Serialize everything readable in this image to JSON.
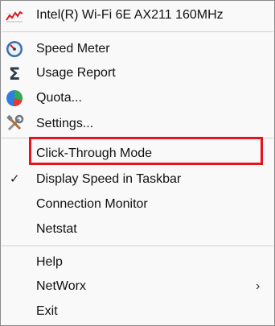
{
  "menu": {
    "adapter_label": "Intel(R) Wi-Fi 6E AX211 160MHz",
    "speed_meter": "Speed Meter",
    "usage_report": "Usage Report",
    "quota": "Quota...",
    "settings": "Settings...",
    "click_through": "Click-Through Mode",
    "display_speed": "Display Speed in Taskbar",
    "connection_monitor": "Connection Monitor",
    "netstat": "Netstat",
    "help": "Help",
    "networx": "NetWorx",
    "exit": "Exit"
  },
  "icons": {
    "adapter": "network-graph-icon",
    "speed_meter": "speedometer-icon",
    "usage_report": "sigma-icon",
    "quota": "pie-chart-icon",
    "settings": "tools-icon",
    "check": "checkmark-icon",
    "submenu": "chevron-right-icon"
  },
  "glyphs": {
    "check": "✓",
    "submenu": "›"
  },
  "colors": {
    "highlight_border": "#e5141e",
    "menu_background": "#f9f9f9"
  }
}
